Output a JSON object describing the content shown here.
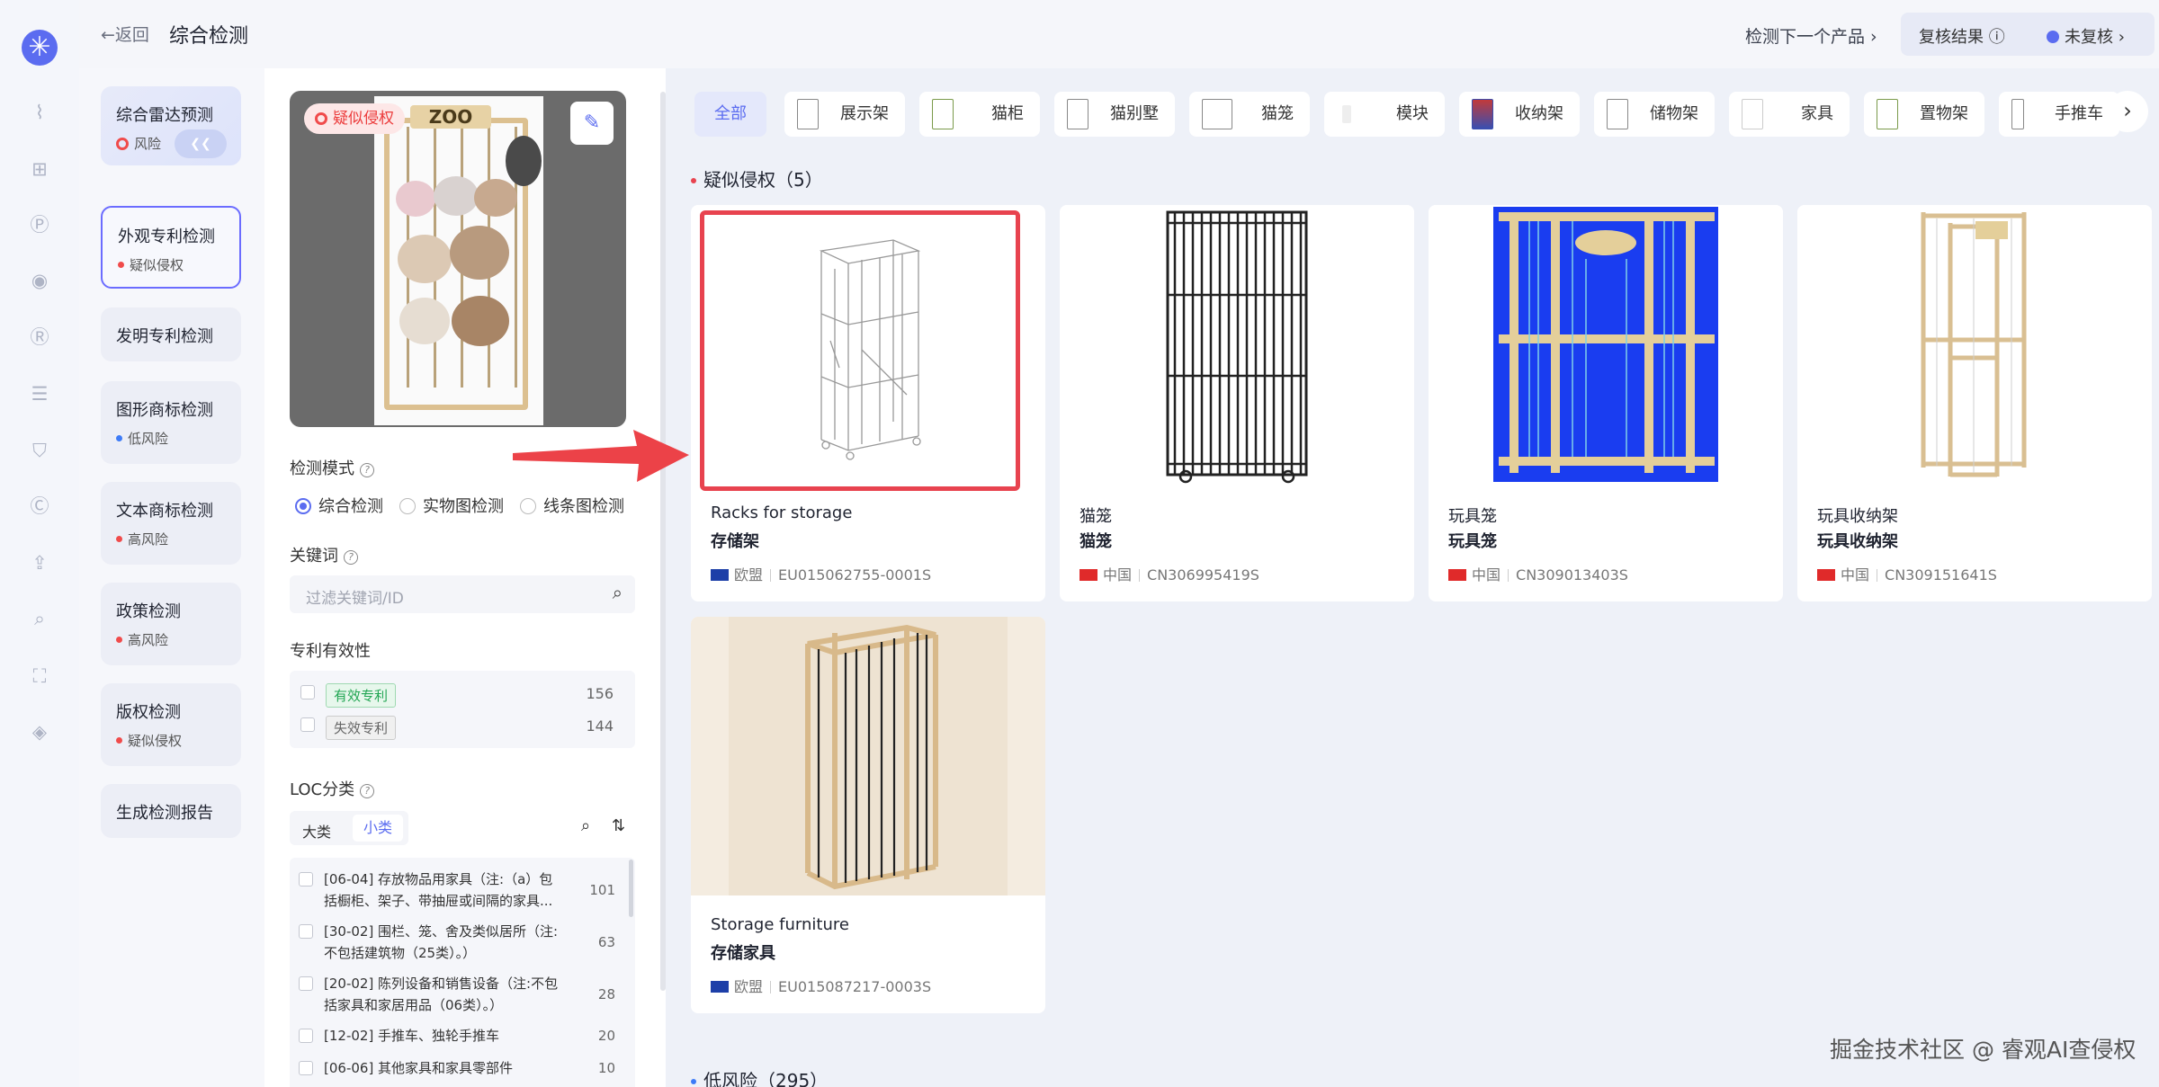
{
  "header": {
    "back_label": "←返回",
    "title": "综合检测",
    "next_product": "检测下一个产品 ›",
    "review_result": "复核结果 ⓘ",
    "review_status": "未复核 ›"
  },
  "rail": {
    "icons": [
      "chart-icon",
      "grid-add-icon",
      "p-icon",
      "bulb-icon",
      "r-icon",
      "doc-icon",
      "shield-check-icon",
      "c-icon",
      "upload-icon",
      "search-zoom-icon",
      "scan-icon",
      "tag-icon"
    ]
  },
  "nav": {
    "items": [
      {
        "title": "综合雷达预测",
        "status": "风险",
        "risk": "ring"
      },
      {
        "title": "外观专利检测",
        "status": "疑似侵权",
        "risk": "red"
      },
      {
        "title": "发明专利检测",
        "status": "",
        "risk": ""
      },
      {
        "title": "图形商标检测",
        "status": "低风险",
        "risk": "blue"
      },
      {
        "title": "文本商标检测",
        "status": "高风险",
        "risk": "red"
      },
      {
        "title": "政策检测",
        "status": "高风险",
        "risk": "red"
      },
      {
        "title": "版权检测",
        "status": "疑似侵权",
        "risk": "red"
      },
      {
        "title": "生成检测报告",
        "status": "",
        "risk": ""
      }
    ]
  },
  "preview": {
    "badge": "疑似侵权",
    "sign": "ZOO"
  },
  "filter": {
    "mode_label": "检测模式",
    "modes": [
      "综合检测",
      "实物图检测",
      "线条图检测"
    ],
    "keyword_label": "关键词",
    "keyword_placeholder": "过滤关键词/ID",
    "validity_label": "专利有效性",
    "validity": [
      {
        "label": "有效专利",
        "count": "156"
      },
      {
        "label": "失效专利",
        "count": "144"
      }
    ],
    "loc_label": "LOC分类",
    "loc_tabs": [
      "大类",
      "小类"
    ],
    "loc_items": [
      {
        "text": "[06-04] 存放物品用家具（注:（a）包",
        "text2": "括橱柜、架子、带抽屉或间隔的家具...",
        "count": "101"
      },
      {
        "text": "[30-02] 围栏、笼、舍及类似居所（注:",
        "text2": "不包括建筑物（25类）。）",
        "count": "63"
      },
      {
        "text": "[20-02] 陈列设备和销售设备（注:不包",
        "text2": "括家具和家居用品（06类）。）",
        "count": "28"
      },
      {
        "text": "[12-02] 手推车、独轮手推车",
        "text2": "",
        "count": "20"
      },
      {
        "text": "[06-06] 其他家具和家具零部件",
        "text2": "",
        "count": "10"
      }
    ]
  },
  "categories": [
    "全部",
    "展示架",
    "猫柜",
    "猫别墅",
    "猫笼",
    "模块",
    "收纳架",
    "储物架",
    "家具",
    "置物架",
    "手推车"
  ],
  "sections": {
    "suspected": "疑似侵权（5）",
    "low": "低风险（295）"
  },
  "results": [
    {
      "name_en": "Racks for storage",
      "name_cn": "存储架",
      "region": "欧盟",
      "id": "EU015062755-0001S",
      "flag": "eu"
    },
    {
      "name_en": "猫笼",
      "name_cn": "猫笼",
      "region": "中国",
      "id": "CN306995419S",
      "flag": "cn"
    },
    {
      "name_en": "玩具笼",
      "name_cn": "玩具笼",
      "region": "中国",
      "id": "CN309013403S",
      "flag": "cn"
    },
    {
      "name_en": "玩具收纳架",
      "name_cn": "玩具收纳架",
      "region": "中国",
      "id": "CN309151641S",
      "flag": "cn"
    },
    {
      "name_en": "Storage furniture",
      "name_cn": "存储家具",
      "region": "欧盟",
      "id": "EU015087217-0003S",
      "flag": "eu"
    }
  ],
  "watermark": "掘金技术社区 @ 睿观AI查侵权",
  "colors": {
    "accent": "#5b6cf0",
    "danger": "#e8434f",
    "low": "#3d7bf7"
  }
}
